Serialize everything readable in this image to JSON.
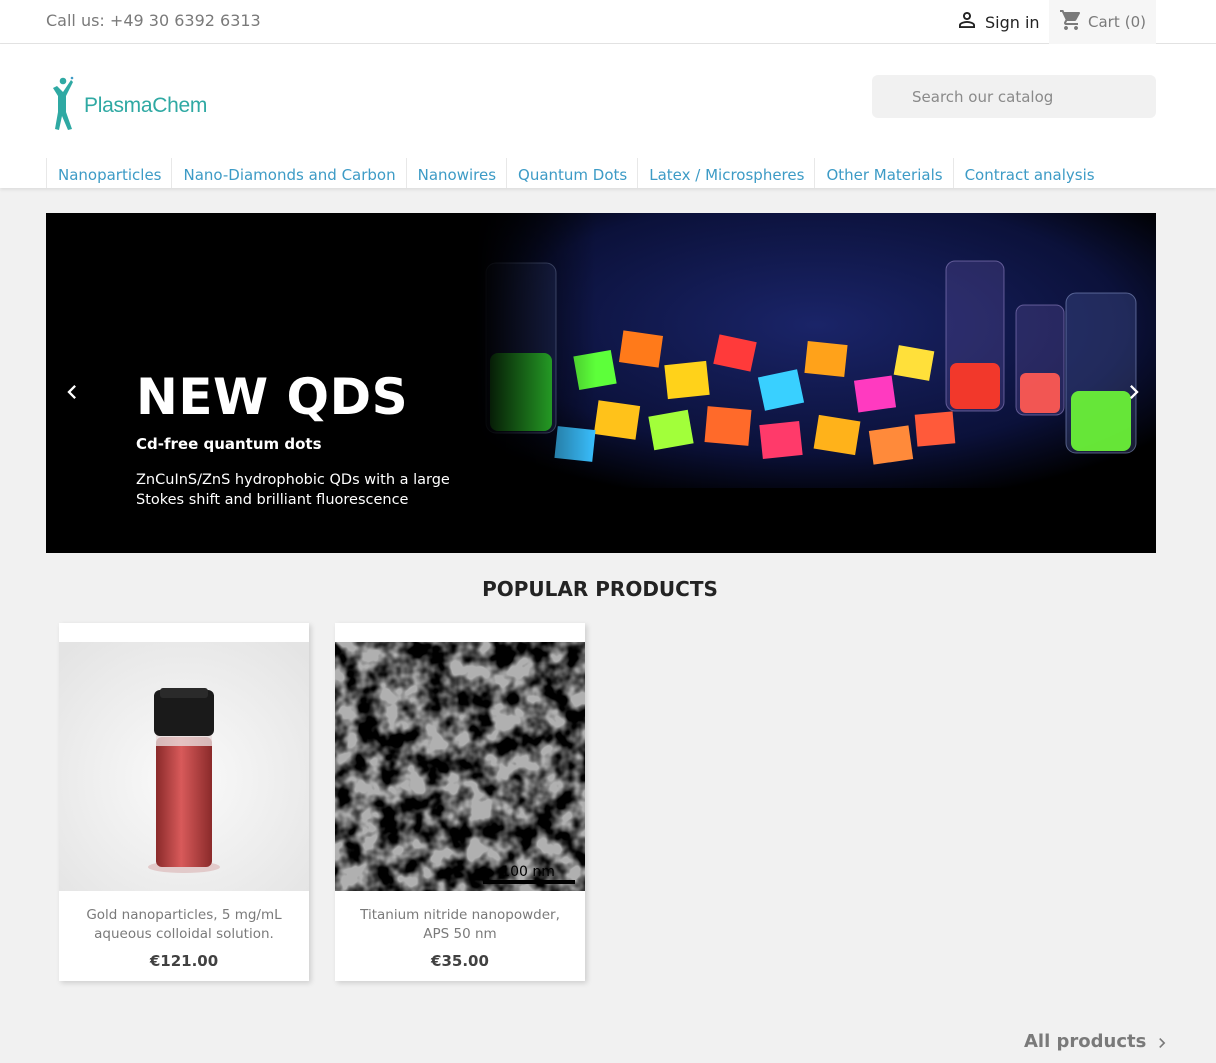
{
  "topbar": {
    "call_us": "Call us: +49 30 6392 6313",
    "sign_in": "Sign in",
    "cart_label": "Cart",
    "cart_count": "(0)"
  },
  "header": {
    "logo_text": "PlasmaChem",
    "search_placeholder": "Search our catalog"
  },
  "menu": {
    "items": [
      "Nanoparticles",
      "Nano-Diamonds and Carbon",
      "Nanowires",
      "Quantum Dots",
      "Latex / Microspheres",
      "Other Materials",
      "Contract analysis"
    ]
  },
  "slider": {
    "title": "NEW QDS",
    "subtitle": "Cd-free quantum dots",
    "description": "ZnCuInS/ZnS hydrophobic QDs with a large Stokes shift and brilliant fluorescence"
  },
  "popular": {
    "title": "POPULAR PRODUCTS",
    "products": [
      {
        "name": "Gold nanoparticles, 5 mg/mL aqueous colloidal solution.",
        "price": "€121.00"
      },
      {
        "name": "Titanium nitride nanopowder, APS 50 nm",
        "price": "€35.00",
        "scale_label": "100 nm"
      }
    ],
    "all_products": "All products"
  },
  "colors": {
    "accent": "#3d9bc6",
    "brand": "#2fa9a3",
    "background": "#f1f1f1"
  },
  "icons": [
    "person-icon",
    "cart-icon",
    "search-icon",
    "chevron-left-icon",
    "chevron-right-icon"
  ]
}
